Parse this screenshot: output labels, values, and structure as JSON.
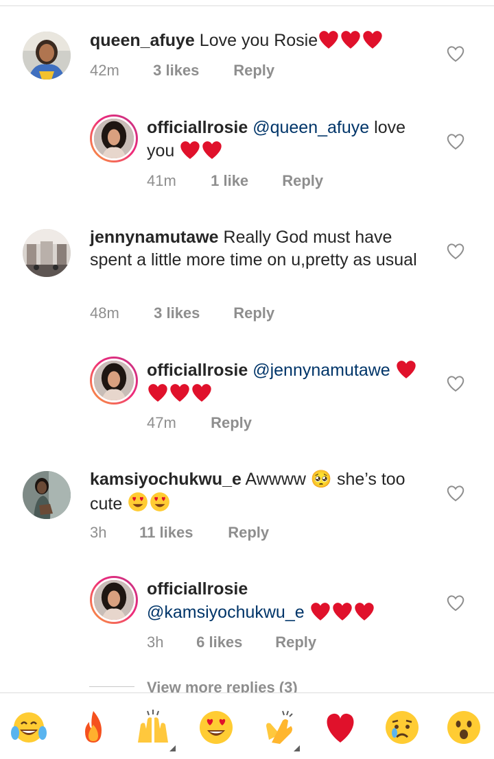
{
  "comments": [
    {
      "username": "queen_afuye",
      "mention": "",
      "text": "Love you Rosie",
      "hearts": 3,
      "time": "42m",
      "likes": "3 likes",
      "reply": "Reply",
      "avatar_icon": "profile-photo"
    },
    {
      "username": "officiallrosie",
      "mention": "@queen_afuye",
      "text": " love you ",
      "hearts": 2,
      "time": "41m",
      "likes": "1 like",
      "reply": "Reply",
      "avatar_icon": "profile-photo-story-ring"
    },
    {
      "username": "jennynamutawe",
      "mention": "",
      "text": "Really God must have spent a little more time on u,pretty as usual",
      "hearts": 0,
      "time": "48m",
      "likes": "3 likes",
      "reply": "Reply",
      "avatar_icon": "profile-photo"
    },
    {
      "username": "officiallrosie",
      "mention": "@jennynamutawe",
      "text": "",
      "hearts": 4,
      "time": "47m",
      "likes": "",
      "reply": "Reply",
      "avatar_icon": "profile-photo-story-ring"
    },
    {
      "username": "kamsiyochukwu_e",
      "mention": "",
      "text": "Awwww 🥺 she’s too cute ",
      "hearts": 0,
      "heart_eyes": 2,
      "time": "3h",
      "likes": "11 likes",
      "reply": "Reply",
      "avatar_icon": "profile-photo"
    },
    {
      "username": "officiallrosie",
      "mention": "@kamsiyochukwu_e",
      "text": " ",
      "hearts": 3,
      "time": "3h",
      "likes": "6 likes",
      "reply": "Reply",
      "avatar_icon": "profile-photo-story-ring"
    }
  ],
  "view_more": "View more replies (3)",
  "emoji_bar": [
    "tears-of-joy",
    "fire",
    "raising-hands",
    "heart-eyes",
    "clapping-hands",
    "red-heart",
    "crying-face",
    "surprised-face"
  ],
  "colors": {
    "text": "#262626",
    "meta": "#8e8e8e",
    "mention": "#003569",
    "heart": "#e0112b",
    "story_ring_start": "#f9a13a",
    "story_ring_end": "#c13584"
  }
}
